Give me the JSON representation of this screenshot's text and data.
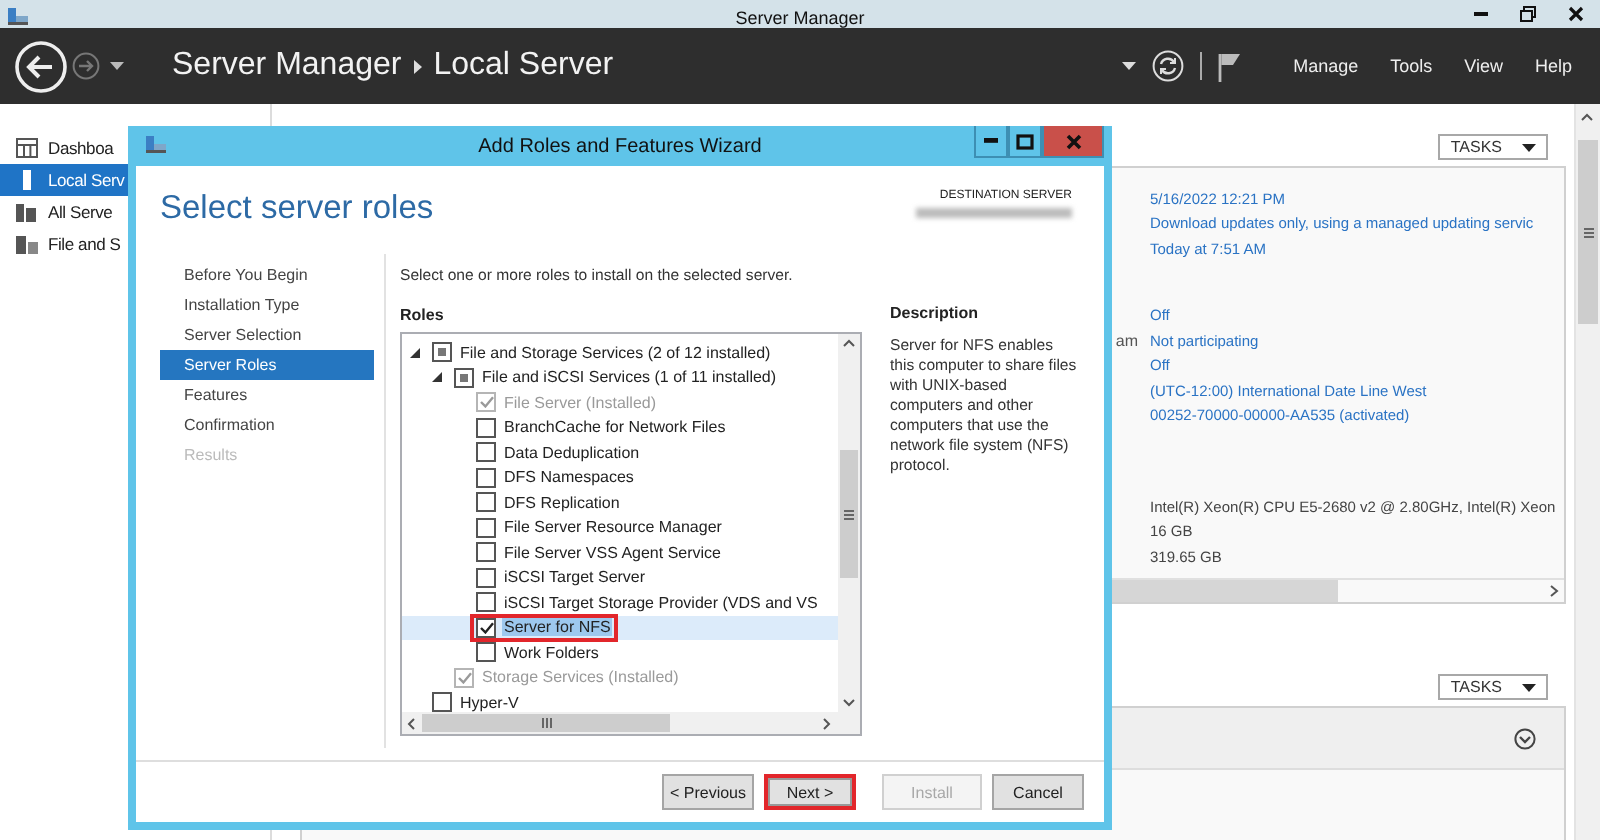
{
  "window": {
    "title": "Server Manager"
  },
  "header": {
    "breadcrumb": [
      "Server Manager",
      "Local Server"
    ],
    "menu": [
      "Manage",
      "Tools",
      "View",
      "Help"
    ]
  },
  "sidebar": {
    "items": [
      {
        "label": "Dashboa",
        "selected": false,
        "kind": "dashboard"
      },
      {
        "label": "Local Serv",
        "selected": true,
        "kind": "local"
      },
      {
        "label": "All Serve",
        "selected": false,
        "kind": "all"
      },
      {
        "label": "File and S",
        "selected": false,
        "kind": "file"
      }
    ]
  },
  "properties": {
    "tasks_label": "TASKS",
    "groups": [
      [
        {
          "value": "5/16/2022 12:21 PM",
          "kind": "link"
        },
        {
          "value": "Download updates only, using a managed updating servic",
          "kind": "link"
        },
        {
          "value": "Today at 7:51 AM",
          "kind": "link"
        }
      ],
      [
        {
          "value": "Off",
          "kind": "link"
        },
        {
          "label": "am",
          "value": "Not participating",
          "kind": "link"
        },
        {
          "value": "Off",
          "kind": "link"
        },
        {
          "value": "(UTC-12:00) International Date Line West",
          "kind": "link"
        },
        {
          "value": "00252-70000-00000-AA535 (activated)",
          "kind": "link"
        }
      ],
      [
        {
          "value": "Intel(R) Xeon(R) CPU E5-2680 v2 @ 2.80GHz, Intel(R) Xeon",
          "kind": "plain"
        },
        {
          "value": "16 GB",
          "kind": "plain"
        },
        {
          "value": "319.65 GB",
          "kind": "plain"
        }
      ]
    ]
  },
  "events": {
    "tasks_label": "TASKS"
  },
  "wizard": {
    "title": "Add Roles and Features Wizard",
    "heading": "Select server roles",
    "destination_label": "DESTINATION SERVER",
    "steps": [
      {
        "label": "Before You Begin",
        "selected": false,
        "disabled": false
      },
      {
        "label": "Installation Type",
        "selected": false,
        "disabled": false
      },
      {
        "label": "Server Selection",
        "selected": false,
        "disabled": false
      },
      {
        "label": "Server Roles",
        "selected": true,
        "disabled": false
      },
      {
        "label": "Features",
        "selected": false,
        "disabled": false
      },
      {
        "label": "Confirmation",
        "selected": false,
        "disabled": false
      },
      {
        "label": "Results",
        "selected": false,
        "disabled": true
      }
    ],
    "instruction": "Select one or more roles to install on the selected server.",
    "roles_label": "Roles",
    "roles": [
      {
        "label": "File and Storage Services (2 of 12 installed)",
        "checked": false,
        "indeterminate": true,
        "disabled": false,
        "selected": false,
        "highlighted": false,
        "expanded": true,
        "children": [
          {
            "label": "File and iSCSI Services (1 of 11 installed)",
            "checked": false,
            "indeterminate": true,
            "disabled": false,
            "selected": false,
            "highlighted": false,
            "expanded": true,
            "children": [
              {
                "label": "File Server (Installed)",
                "checked": true,
                "indeterminate": false,
                "disabled": true,
                "selected": false,
                "highlighted": false
              },
              {
                "label": "BranchCache for Network Files",
                "checked": false,
                "indeterminate": false,
                "disabled": false,
                "selected": false,
                "highlighted": false
              },
              {
                "label": "Data Deduplication",
                "checked": false,
                "indeterminate": false,
                "disabled": false,
                "selected": false,
                "highlighted": false
              },
              {
                "label": "DFS Namespaces",
                "checked": false,
                "indeterminate": false,
                "disabled": false,
                "selected": false,
                "highlighted": false
              },
              {
                "label": "DFS Replication",
                "checked": false,
                "indeterminate": false,
                "disabled": false,
                "selected": false,
                "highlighted": false
              },
              {
                "label": "File Server Resource Manager",
                "checked": false,
                "indeterminate": false,
                "disabled": false,
                "selected": false,
                "highlighted": false
              },
              {
                "label": "File Server VSS Agent Service",
                "checked": false,
                "indeterminate": false,
                "disabled": false,
                "selected": false,
                "highlighted": false
              },
              {
                "label": "iSCSI Target Server",
                "checked": false,
                "indeterminate": false,
                "disabled": false,
                "selected": false,
                "highlighted": false
              },
              {
                "label": "iSCSI Target Storage Provider (VDS and VS",
                "checked": false,
                "indeterminate": false,
                "disabled": false,
                "selected": false,
                "highlighted": false
              },
              {
                "label": "Server for NFS",
                "checked": true,
                "indeterminate": false,
                "disabled": false,
                "selected": true,
                "highlighted": true
              },
              {
                "label": "Work Folders",
                "checked": false,
                "indeterminate": false,
                "disabled": false,
                "selected": false,
                "highlighted": false
              }
            ]
          },
          {
            "label": "Storage Services (Installed)",
            "checked": true,
            "indeterminate": false,
            "disabled": true,
            "selected": false,
            "highlighted": false
          }
        ]
      },
      {
        "label": "Hyper-V",
        "checked": false,
        "indeterminate": false,
        "disabled": false,
        "selected": false,
        "highlighted": false
      }
    ],
    "description_label": "Description",
    "description": "Server for NFS enables this computer to share files with UNIX-based computers and other computers that use the network file system (NFS) protocol.",
    "buttons": [
      {
        "label": "< Previous",
        "disabled": false,
        "highlighted": false
      },
      {
        "label": "Next >",
        "disabled": false,
        "highlighted": true
      },
      {
        "label": "Install",
        "disabled": true,
        "highlighted": false
      },
      {
        "label": "Cancel",
        "disabled": false,
        "highlighted": false
      }
    ]
  }
}
